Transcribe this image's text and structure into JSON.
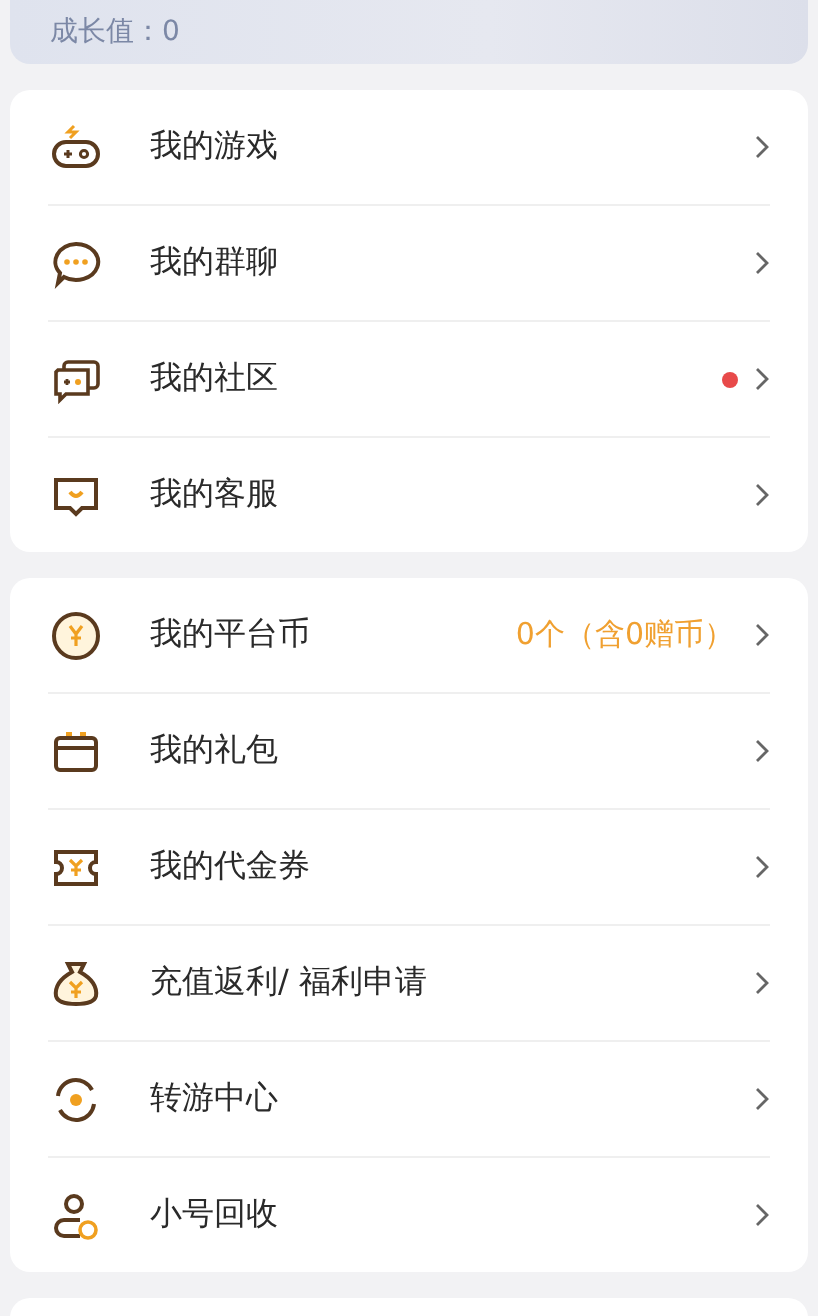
{
  "profile": {
    "growth": "成长值：0"
  },
  "groups": [
    {
      "items": [
        {
          "label": "我的游戏",
          "unread": false
        },
        {
          "label": "我的群聊",
          "unread": false
        },
        {
          "label": "我的社区",
          "unread": true
        },
        {
          "label": "我的客服",
          "unread": false
        }
      ]
    },
    {
      "items": [
        {
          "label": "我的平台币",
          "unread": false,
          "value": "0个（含0赠币）"
        },
        {
          "label": "我的礼包",
          "unread": false
        },
        {
          "label": "我的代金券",
          "unread": false
        },
        {
          "label": "充值返利/ 福利申请",
          "unread": false
        },
        {
          "label": "转游中心",
          "unread": false
        },
        {
          "label": "小号回收",
          "unread": false
        }
      ]
    }
  ]
}
